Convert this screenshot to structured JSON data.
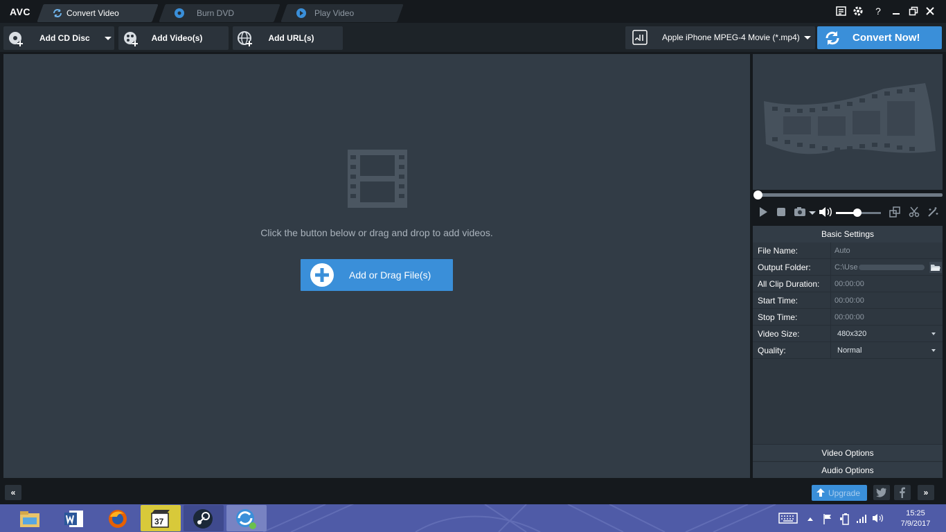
{
  "app": {
    "logo": "AVC",
    "tabs": [
      {
        "label": "Convert Video",
        "icon": "refresh-icon",
        "active": true
      },
      {
        "label": "Burn DVD",
        "icon": "disc-icon",
        "active": false
      },
      {
        "label": "Play Video",
        "icon": "play-icon",
        "active": false
      }
    ],
    "window_controls": [
      "menu-icon",
      "settings-icon",
      "help-icon",
      "minimize-icon",
      "restore-icon",
      "close-icon"
    ],
    "help_glyph": "?"
  },
  "toolbar": {
    "add_cd": "Add CD Disc",
    "add_videos": "Add Video(s)",
    "add_url": "Add URL(s)",
    "format": "Apple iPhone MPEG-4 Movie (*.mp4)",
    "convert": "Convert Now!",
    "accent": "#3a8fd9"
  },
  "main": {
    "hint": "Click the button below or drag and drop to add videos.",
    "add_button": "Add or Drag File(s)"
  },
  "player": {
    "seek_progress": 0,
    "volume": 0.45
  },
  "settings": {
    "title": "Basic Settings",
    "rows": [
      {
        "key": "File Name:",
        "value": "Auto"
      },
      {
        "key": "Output Folder:",
        "value": "C:\\Use"
      },
      {
        "key": "All Clip Duration:",
        "value": "00:00:00"
      },
      {
        "key": "Start Time:",
        "value": "00:00:00"
      },
      {
        "key": "Stop Time:",
        "value": "00:00:00"
      },
      {
        "key": "Video Size:",
        "value": "480x320"
      },
      {
        "key": "Quality:",
        "value": "Normal"
      }
    ],
    "video_options": "Video Options",
    "audio_options": "Audio Options"
  },
  "statusbar": {
    "collapse": "«",
    "upgrade": "Upgrade",
    "expand": "»"
  },
  "taskbar": {
    "apps": [
      "file-explorer-icon",
      "word-icon",
      "firefox-icon",
      "media-player-icon",
      "steam-icon",
      "avc-icon"
    ],
    "time": "15:25",
    "date": "7/9/2017"
  }
}
